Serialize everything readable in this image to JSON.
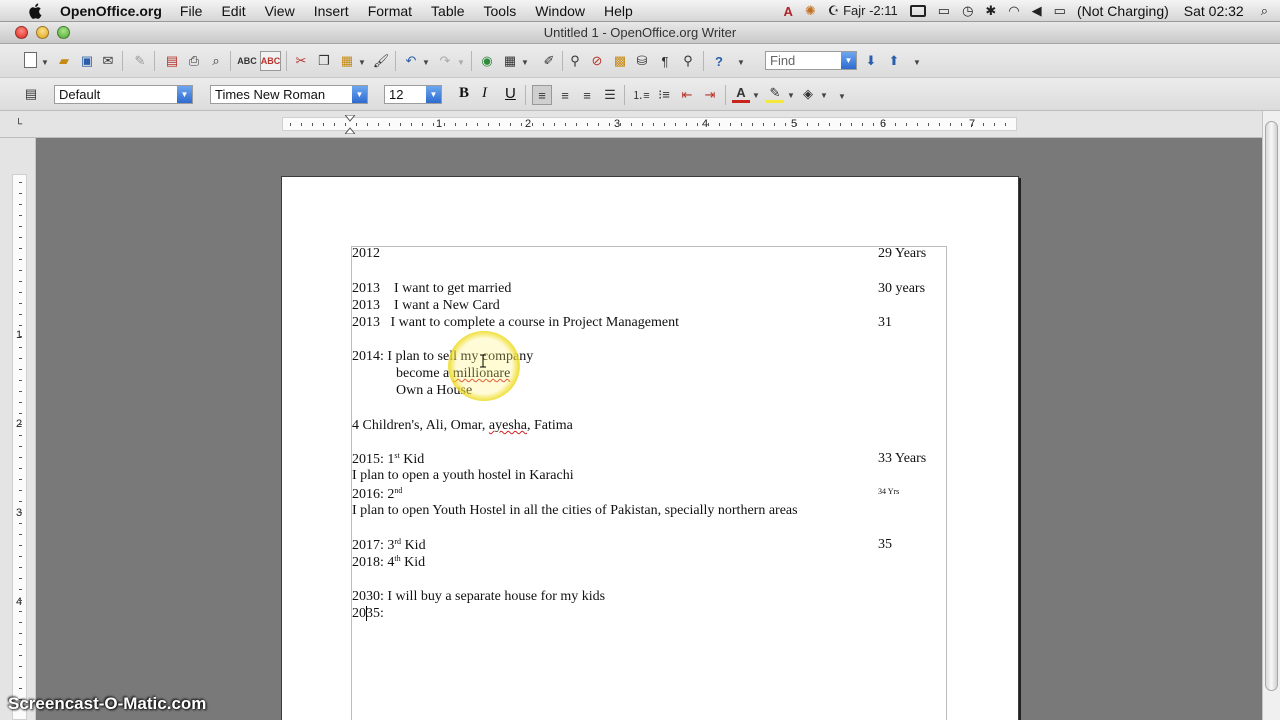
{
  "menubar": {
    "app": "OpenOffice.org",
    "menus": [
      "File",
      "Edit",
      "View",
      "Insert",
      "Format",
      "Table",
      "Tools",
      "Window",
      "Help"
    ],
    "prayer": "Fajr -2:11",
    "battery": "(Not Charging)",
    "clock": "Sat 02:32"
  },
  "window": {
    "title": "Untitled 1 - OpenOffice.org Writer"
  },
  "toolbar": {
    "find_placeholder": "Find",
    "paragraph_style": "Default",
    "font_name": "Times New Roman",
    "font_size": "12",
    "bold": "B",
    "italic": "I",
    "underline": "U"
  },
  "ruler": {
    "h_numbers": [
      "1",
      "2",
      "3",
      "4",
      "5",
      "6",
      "7"
    ],
    "v_numbers": [
      "1",
      "2",
      "3",
      "4"
    ]
  },
  "document": {
    "lines": [
      {
        "left": "2012",
        "right": "29 Years"
      },
      {
        "left": "2013    I want to get married",
        "right": "30 years"
      },
      {
        "left": "2013    I want a New Card",
        "right": ""
      },
      {
        "left": "2013   I want to complete a course in Project Management",
        "right": "31"
      },
      {
        "left": "2014: I plan to sell my company",
        "right": ""
      },
      {
        "left": "become a ",
        "spell": "millionare",
        "right": ""
      },
      {
        "left": "Own a House",
        "right": ""
      },
      {
        "left": "4 Children's, Ali, Omar, ",
        "spell": "ayesha",
        "after": ", Fatima",
        "right": ""
      },
      {
        "left": "2015: 1",
        "sup": "st",
        "after": " Kid",
        "right": "33 Years"
      },
      {
        "left": "I plan to open a youth hostel in Karachi",
        "right": ""
      },
      {
        "left": "2016: 2",
        "sup": "nd",
        "right": "34 Yrs"
      },
      {
        "left": "I plan to open Youth Hostel in all the cities of Pakistan, specially northern areas",
        "right": ""
      },
      {
        "left": "2017: 3",
        "sup": "rd",
        "after": " Kid",
        "right": "35"
      },
      {
        "left": "2018: 4",
        "sup": "th",
        "after": " Kid",
        "right": ""
      },
      {
        "left": "2030: I will buy a separate house for my kids",
        "right": ""
      },
      {
        "left": "2035:",
        "right": ""
      }
    ]
  },
  "watermark": "Screencast-O-Matic.com",
  "colors": {
    "menubar": "#e6e6e6",
    "workspace": "#797979",
    "page": "#ffffff",
    "spell": "#d02020"
  }
}
